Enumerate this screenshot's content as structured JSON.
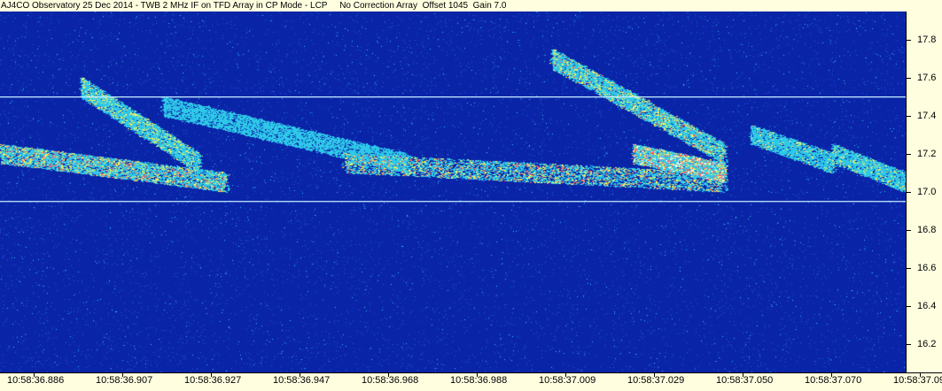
{
  "header": {
    "title": "AJ4CO Observatory 25 Dec 2014 - TWB 2 MHz IF on TFD Array in CP Mode - LCP",
    "correction": "No Correction Array",
    "offset": "Offset 1045",
    "gain": "Gain 7.0"
  },
  "chart_data": {
    "type": "heatmap",
    "title": "AJ4CO Observatory 25 Dec 2014 - TWB 2 MHz IF on TFD Array in CP Mode - LCP",
    "xlabel": "",
    "ylabel": "",
    "x_ticks": [
      "10:58:36.886",
      "10:58:36.907",
      "10:58:36.927",
      "10:58:36.947",
      "10:58:36.968",
      "10:58:36.988",
      "10:58:37.009",
      "10:58:37.029",
      "10:58:37.050",
      "10:58:37.070",
      "10:58:37.091"
    ],
    "y_ticks": [
      17.8,
      17.6,
      17.4,
      17.2,
      17.0,
      16.8,
      16.6,
      16.4,
      16.2
    ],
    "ylim": [
      16.05,
      17.95
    ],
    "colormap": [
      "#0a24a8",
      "#1e5bd8",
      "#2ec8e8",
      "#f0f060",
      "#ff6060",
      "#ffffff"
    ],
    "interference_lines": [
      17.5,
      16.95
    ],
    "bursts": [
      {
        "x": [
          0.0,
          0.25
        ],
        "y": [
          17.2,
          17.05
        ],
        "intensity": 0.8
      },
      {
        "x": [
          0.09,
          0.22
        ],
        "y": [
          17.55,
          17.15
        ],
        "intensity": 0.7
      },
      {
        "x": [
          0.18,
          0.45
        ],
        "y": [
          17.45,
          17.15
        ],
        "intensity": 0.55
      },
      {
        "x": [
          0.38,
          0.8
        ],
        "y": [
          17.15,
          17.05
        ],
        "intensity": 0.8
      },
      {
        "x": [
          0.61,
          0.8
        ],
        "y": [
          17.7,
          17.2
        ],
        "intensity": 0.75
      },
      {
        "x": [
          0.7,
          0.8
        ],
        "y": [
          17.2,
          17.1
        ],
        "intensity": 0.95
      },
      {
        "x": [
          0.83,
          0.92
        ],
        "y": [
          17.3,
          17.15
        ],
        "intensity": 0.6
      },
      {
        "x": [
          0.92,
          1.0
        ],
        "y": [
          17.2,
          17.05
        ],
        "intensity": 0.65
      }
    ]
  }
}
